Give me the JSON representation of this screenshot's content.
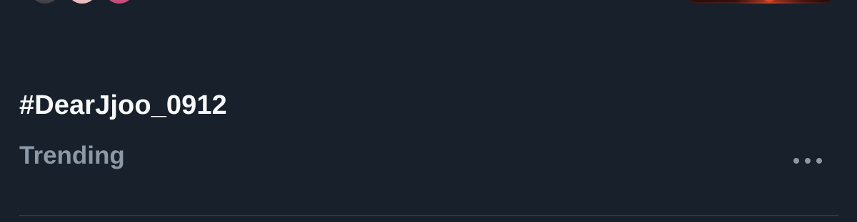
{
  "trend": {
    "title": "#DearJjoo_0912",
    "meta": "Trending"
  },
  "icons": {
    "more": "more-horizontal-icon"
  },
  "colors": {
    "background": "#17202b",
    "primary_text": "#f7f9f9",
    "secondary_text": "#8b98a5",
    "divider": "#3a4652"
  }
}
